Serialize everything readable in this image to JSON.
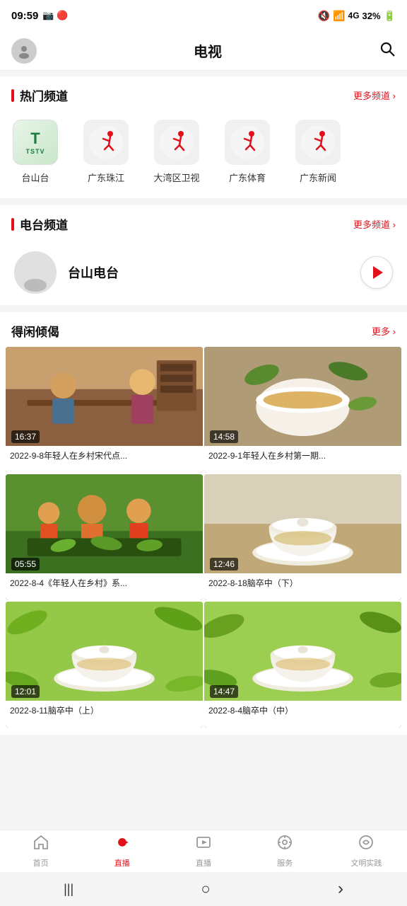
{
  "statusBar": {
    "time": "09:59",
    "battery": "32%",
    "signal": "4G"
  },
  "topNav": {
    "title": "电视",
    "searchLabel": "搜索"
  },
  "hotChannels": {
    "sectionTitle": "热门频道",
    "moreLabel": "更多频道",
    "channels": [
      {
        "id": "tstv",
        "name": "台山台",
        "type": "tstv"
      },
      {
        "id": "gdzj",
        "name": "广东珠江",
        "type": "runner"
      },
      {
        "id": "dawan",
        "name": "大湾区卫视",
        "type": "runner"
      },
      {
        "id": "gdty",
        "name": "广东体育",
        "type": "runner"
      },
      {
        "id": "gdxw",
        "name": "广东新闻",
        "type": "runner"
      }
    ]
  },
  "radioChannels": {
    "sectionTitle": "电台频道",
    "moreLabel": "更多频道",
    "station": {
      "name": "台山电台",
      "playLabel": "播放"
    }
  },
  "videoSection": {
    "sectionTitle": "得闲倾偈",
    "moreLabel": "更多",
    "videos": [
      {
        "id": "v1",
        "title": "2022-9-8年轻人在乡村宋代点...",
        "duration": "16:37",
        "thumbType": "tea-talk"
      },
      {
        "id": "v2",
        "title": "2022-9-1年轻人在乡村第一期...",
        "duration": "14:58",
        "thumbType": "tea-cup"
      },
      {
        "id": "v3",
        "title": "2022-8-4《年轻人在乡村》系...",
        "duration": "05:55",
        "thumbType": "tea-harvest"
      },
      {
        "id": "v4",
        "title": "2022-8-18脑卒中（下）",
        "duration": "12:46",
        "thumbType": "white-bowl"
      },
      {
        "id": "v5",
        "title": "2022-8-11脑卒中（上）",
        "duration": "12:01",
        "thumbType": "bowl2"
      },
      {
        "id": "v6",
        "title": "2022-8-4脑卒中（中）",
        "duration": "14:47",
        "thumbType": "bowl3"
      }
    ]
  },
  "bottomNav": {
    "items": [
      {
        "id": "home",
        "label": "首页",
        "icon": "⌂",
        "active": false
      },
      {
        "id": "live",
        "label": "直播",
        "icon": "▶",
        "active": true
      },
      {
        "id": "play",
        "label": "直播",
        "icon": "▷",
        "active": false
      },
      {
        "id": "service",
        "label": "服务",
        "icon": "◎",
        "active": false
      },
      {
        "id": "culture",
        "label": "文明实践",
        "icon": "⊙",
        "active": false
      }
    ]
  },
  "androidNav": {
    "back": "‹",
    "home": "○",
    "recent": "|||"
  }
}
